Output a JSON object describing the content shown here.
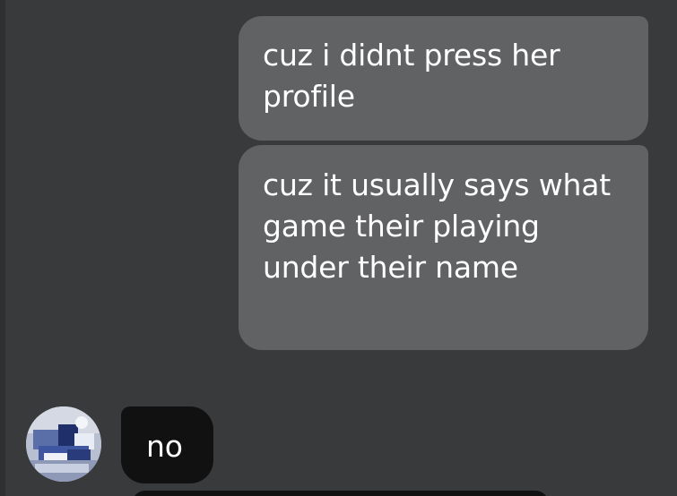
{
  "messages": [
    {
      "direction": "outgoing",
      "text": "cuz i didnt press her profile"
    },
    {
      "direction": "outgoing",
      "text": "cuz it usually says what game their playing under their name"
    },
    {
      "direction": "incoming",
      "text": "no"
    }
  ],
  "colors": {
    "background": "#393a3c",
    "outgoing_bubble": "#616264",
    "incoming_bubble": "#111112",
    "text": "#ffffff"
  }
}
